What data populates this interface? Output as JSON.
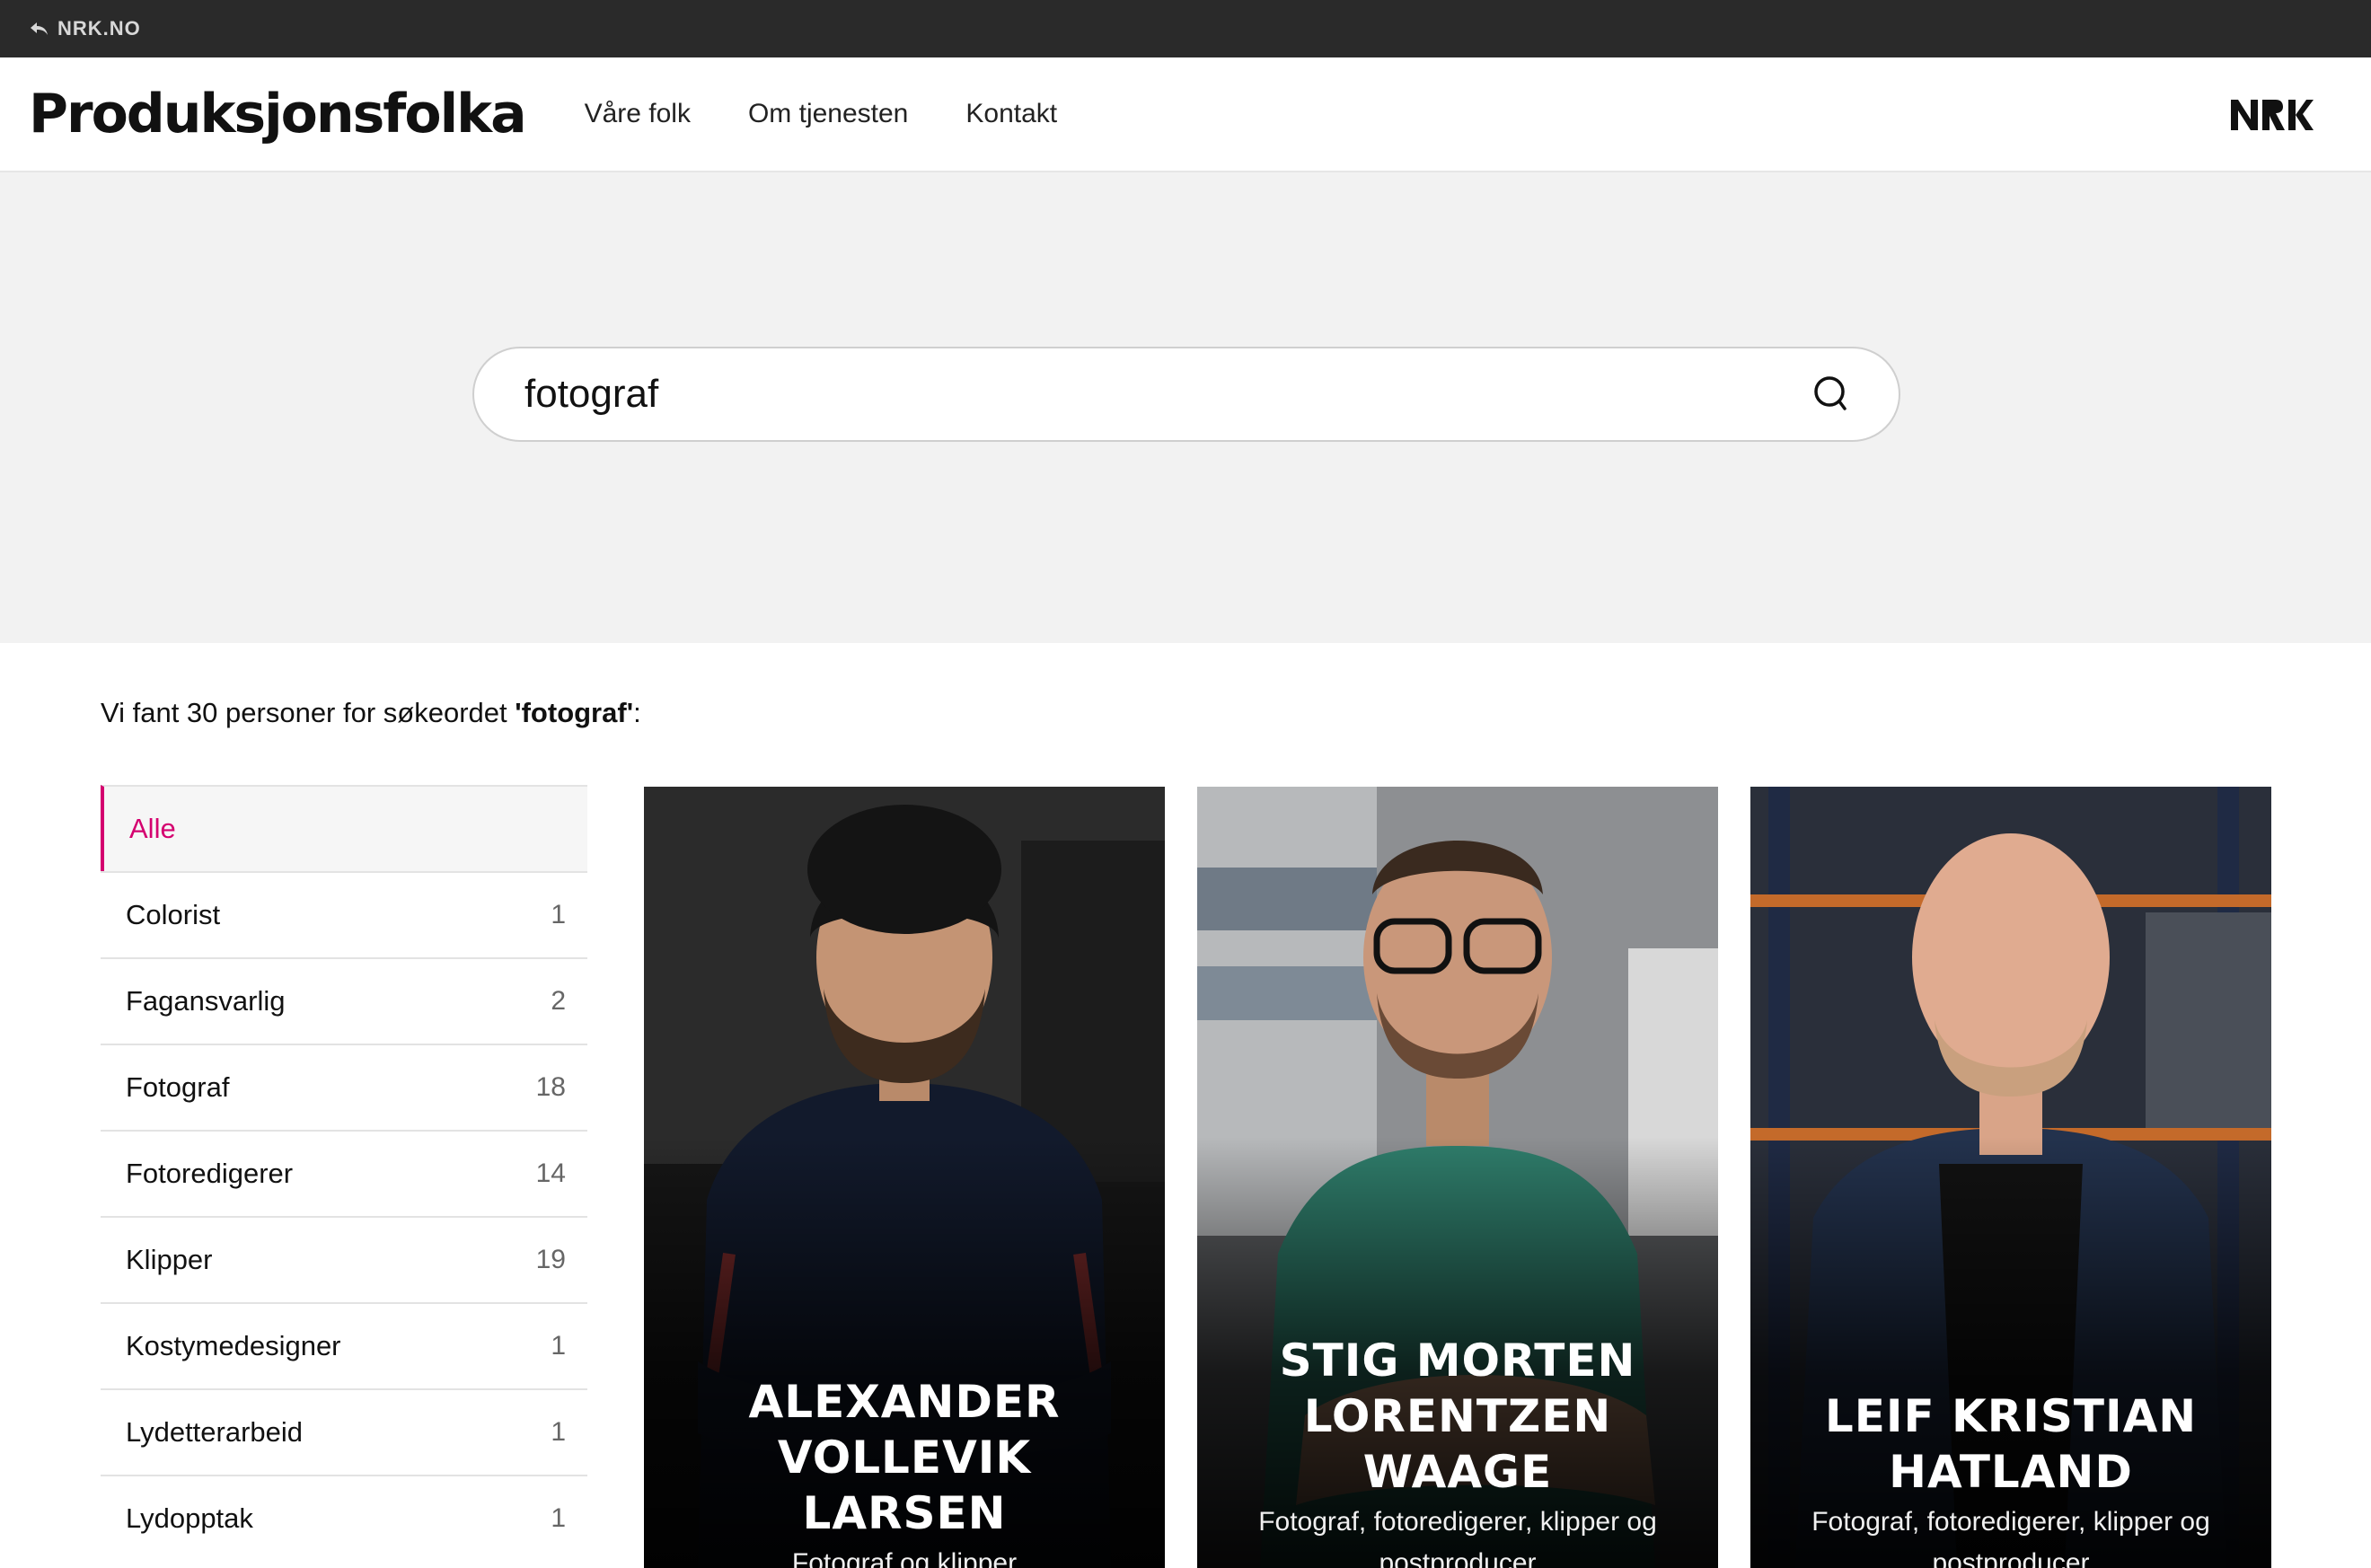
{
  "topbar": {
    "back_label": "NRK.NO"
  },
  "header": {
    "brand": "Produksjonsfolka",
    "nav": [
      "Våre folk",
      "Om tjenesten",
      "Kontakt"
    ],
    "logo": "NRK"
  },
  "search": {
    "value": "fotograf",
    "icon": "search-icon"
  },
  "results": {
    "prefix": "Vi fant 30 personer for søkeordet ",
    "term": "'fotograf'",
    "suffix": ":"
  },
  "filters": [
    {
      "label": "Alle",
      "count": ""
    },
    {
      "label": "Colorist",
      "count": "1"
    },
    {
      "label": "Fagansvarlig",
      "count": "2"
    },
    {
      "label": "Fotograf",
      "count": "18"
    },
    {
      "label": "Fotoredigerer",
      "count": "14"
    },
    {
      "label": "Klipper",
      "count": "19"
    },
    {
      "label": "Kostymedesigner",
      "count": "1"
    },
    {
      "label": "Lydetterarbeid",
      "count": "1"
    },
    {
      "label": "Lydopptak",
      "count": "1"
    }
  ],
  "people": [
    {
      "name_lines": [
        "ALEXANDER",
        "VOLLEVIK LARSEN"
      ],
      "role_lines": [
        "Fotograf og klipper"
      ]
    },
    {
      "name_lines": [
        "STIG MORTEN",
        "LORENTZEN",
        "WAAGE"
      ],
      "role_lines": [
        "Fotograf, fotoredigerer, klipper og",
        "postproducer"
      ]
    },
    {
      "name_lines": [
        "LEIF KRISTIAN",
        "HATLAND"
      ],
      "role_lines": [
        "Fotograf, fotoredigerer, klipper og",
        "postproducer"
      ]
    }
  ],
  "colors": {
    "accent": "#d4006f",
    "topbar": "#2a2a2a",
    "hero": "#f2f2f2"
  }
}
